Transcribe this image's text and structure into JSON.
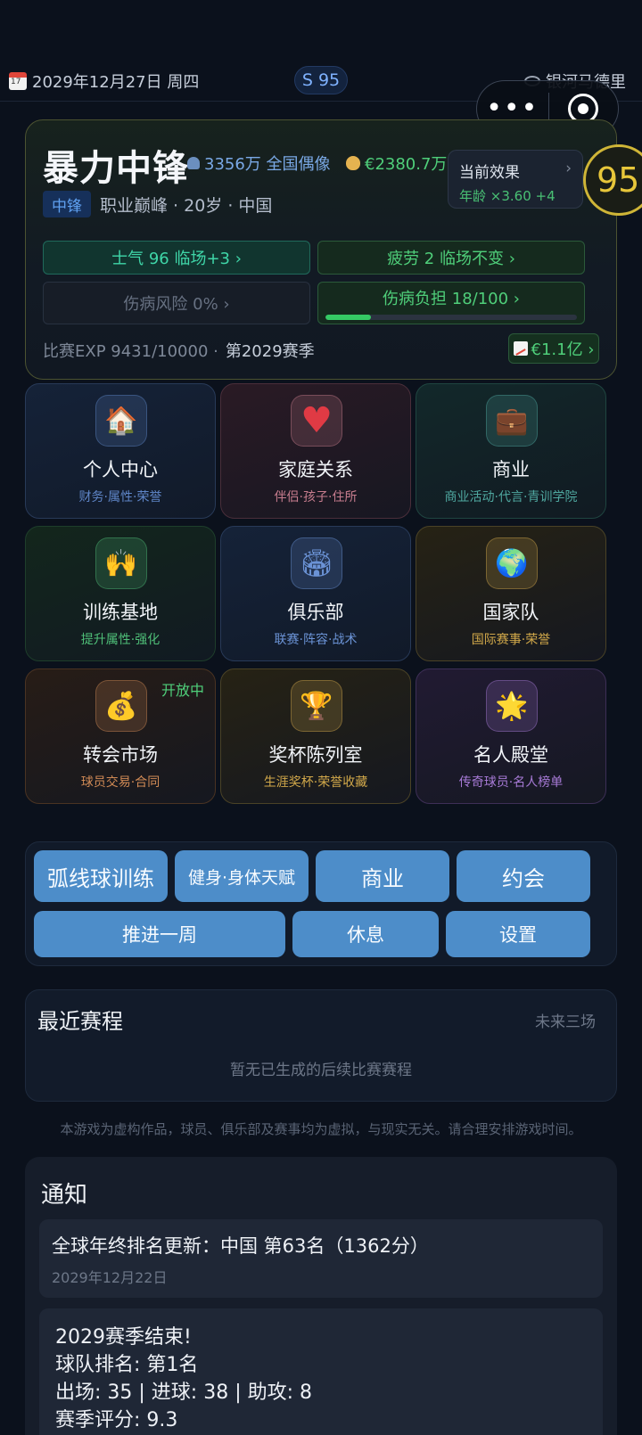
{
  "status": {
    "date": "2029年12月27日 周四",
    "overall_pill": "S 95",
    "club": "银河马德里"
  },
  "player": {
    "name": "暴力中锋",
    "fans": "3356万 全国偶像",
    "money": "€2380.7万",
    "position": "中锋",
    "meta": "职业巅峰 · 20岁 · 中国",
    "effect_title": "当前效果",
    "effect_arrow": "›",
    "effect_value": "年龄 ×3.60 +4",
    "overall": "95",
    "morale": "士气 96  临场+3 ›",
    "fatigue": "疲劳 2  临场不变 ›",
    "injury_risk": "伤病风险 0% ›",
    "injury_burden": "伤病负担 18/100 ›",
    "injury_burden_fraction": 0.18,
    "exp_label": "比赛EXP 9431/10000 ·",
    "season": "第2029赛季",
    "market_value": "€1.1亿 ›"
  },
  "menu": [
    {
      "title": "个人中心",
      "sub": "财务·属性·荣誉",
      "icon": "house-icon",
      "glyph": "🏠",
      "accent": "#5f86c8"
    },
    {
      "title": "家庭关系",
      "sub": "伴侣·孩子·住所",
      "icon": "heart-icon",
      "glyph": "♥",
      "accent": "#c77d8e"
    },
    {
      "title": "商业",
      "sub": "商业活动·代言·青训学院",
      "icon": "briefcase-icon",
      "glyph": "💼",
      "accent": "#4fa8a0"
    },
    {
      "title": "训练基地",
      "sub": "提升属性·强化",
      "icon": "athlete-icon",
      "glyph": "🙌",
      "accent": "#4fbf78"
    },
    {
      "title": "俱乐部",
      "sub": "联赛·阵容·战术",
      "icon": "stadium-icon",
      "glyph": "🏟",
      "accent": "#6b93d6"
    },
    {
      "title": "国家队",
      "sub": "国际赛事·荣誉",
      "icon": "globe-icon",
      "glyph": "🌍",
      "accent": "#d1a84a"
    },
    {
      "title": "转会市场",
      "sub": "球员交易·合同",
      "icon": "money-bag-icon",
      "glyph": "💰",
      "accent": "#d08a55",
      "badge": "开放中"
    },
    {
      "title": "奖杯陈列室",
      "sub": "生涯奖杯·荣誉收藏",
      "icon": "trophy-icon",
      "glyph": "🏆",
      "accent": "#d1a84a"
    },
    {
      "title": "名人殿堂",
      "sub": "传奇球员·名人榜单",
      "icon": "star-icon",
      "glyph": "🌟",
      "accent": "#a77ad6"
    }
  ],
  "actions": {
    "curve_training": "弧线球训练",
    "fitness": "健身·身体天赋",
    "business": "商业",
    "date": "约会",
    "advance_week": "推进一周",
    "rest": "休息",
    "settings": "设置"
  },
  "schedule": {
    "title": "最近赛程",
    "more": "未来三场",
    "empty": "暂无已生成的后续比赛赛程"
  },
  "disclaimer": "本游戏为虚构作品，球员、俱乐部及赛事均为虚拟，与现实无关。请合理安排游戏时间。",
  "notices": {
    "title": "通知",
    "items": [
      {
        "text": "全球年终排名更新：中国 第63名（1362分）",
        "date": "2029年12月22日"
      },
      {
        "lines": [
          "2029赛季结束!",
          "球队排名: 第1名",
          "出场: 35 | 进球: 38 | 助攻: 8",
          "赛季评分: 9.3"
        ]
      }
    ]
  }
}
